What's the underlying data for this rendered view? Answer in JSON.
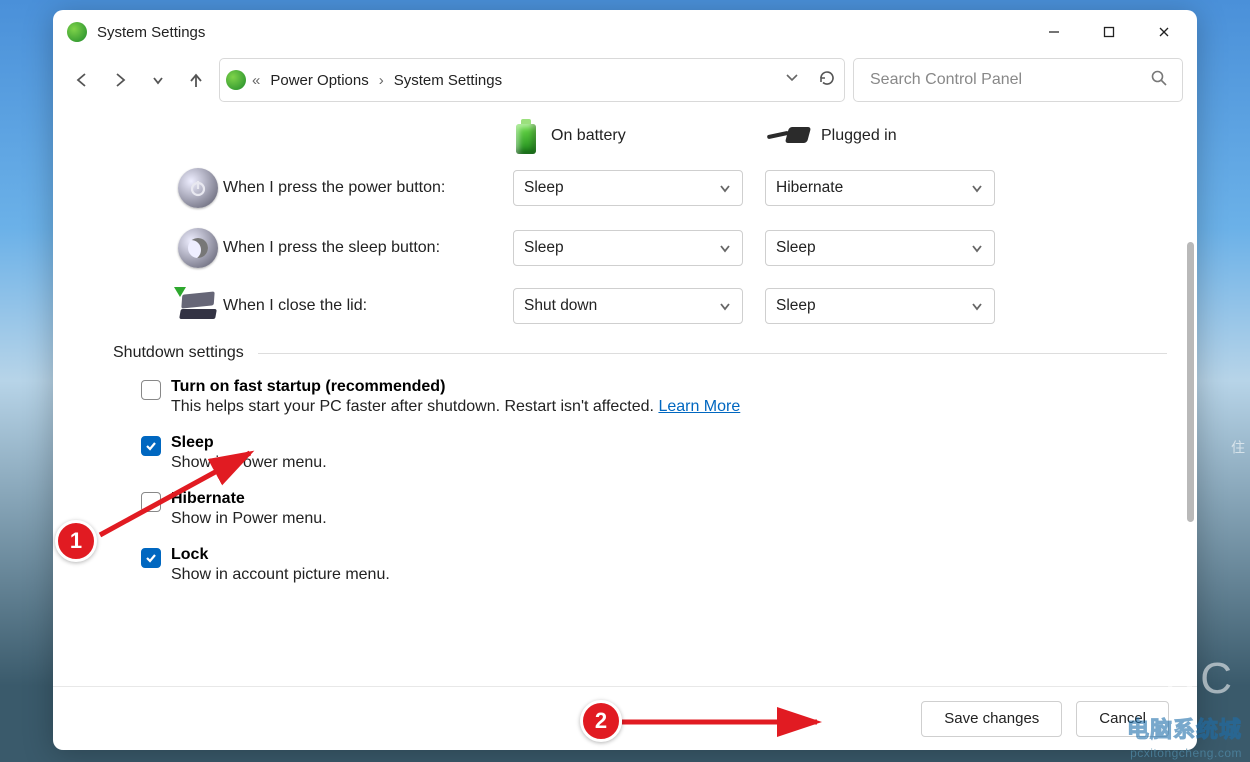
{
  "window": {
    "title": "System Settings"
  },
  "breadcrumb": {
    "prefix": "«",
    "part1": "Power Options",
    "part2": "System Settings"
  },
  "search": {
    "placeholder": "Search Control Panel"
  },
  "columns": {
    "battery": "On battery",
    "plugged": "Plugged in"
  },
  "rows": {
    "power_button": {
      "label": "When I press the power button:",
      "battery": "Sleep",
      "plugged": "Hibernate"
    },
    "sleep_button": {
      "label": "When I press the sleep button:",
      "battery": "Sleep",
      "plugged": "Sleep"
    },
    "close_lid": {
      "label": "When I close the lid:",
      "battery": "Shut down",
      "plugged": "Sleep"
    }
  },
  "section": {
    "shutdown": "Shutdown settings"
  },
  "checks": {
    "fast_startup": {
      "label": "Turn on fast startup (recommended)",
      "desc": "This helps start your PC faster after shutdown. Restart isn't affected.",
      "learn": "Learn More",
      "checked": false
    },
    "sleep": {
      "label": "Sleep",
      "desc": "Show in Power menu.",
      "checked": true
    },
    "hibernate": {
      "label": "Hibernate",
      "desc": "Show in Power menu.",
      "checked": false
    },
    "lock": {
      "label": "Lock",
      "desc": "Show in account picture menu.",
      "checked": true
    }
  },
  "buttons": {
    "save": "Save changes",
    "cancel": "Cancel"
  },
  "annotations": {
    "badge1": "1",
    "badge2": "2"
  },
  "watermark": {
    "cn": "电脑系统城",
    "en": "pcxitongcheng.com",
    "dc": "DC",
    "side": "住"
  }
}
